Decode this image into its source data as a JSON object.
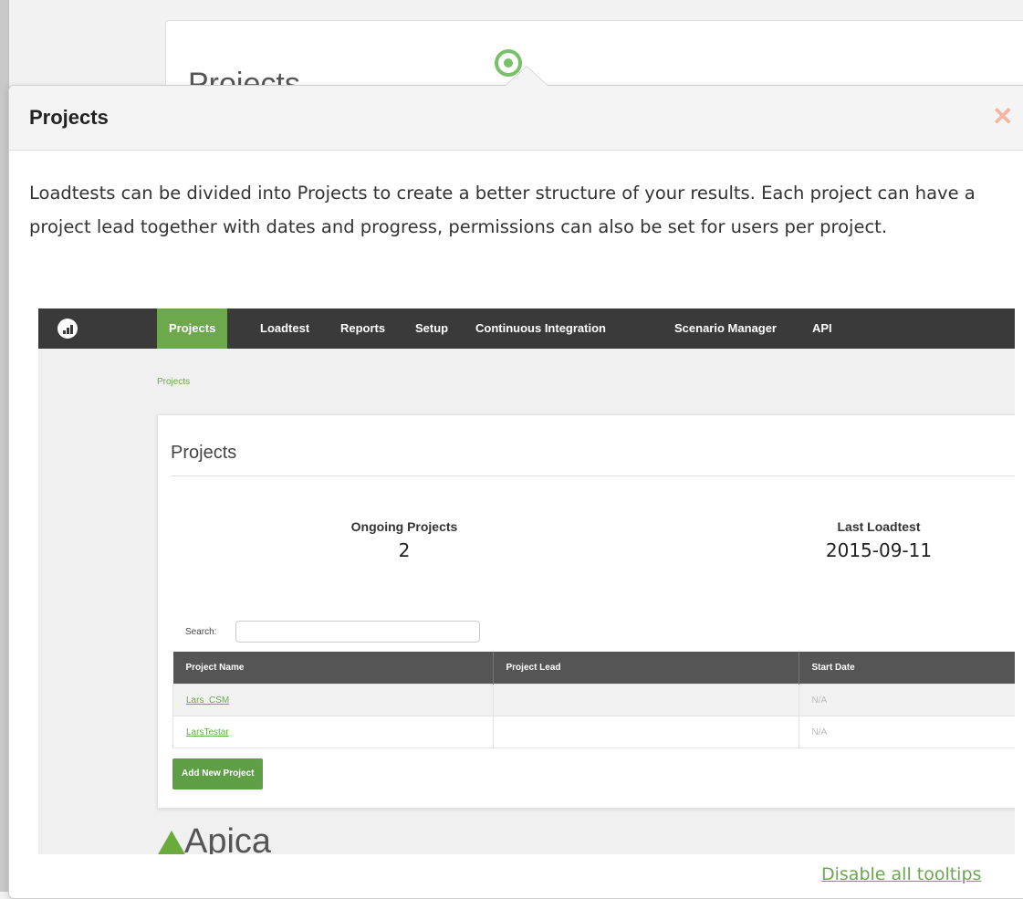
{
  "background": {
    "card_title": "Projects"
  },
  "popover": {
    "title": "Projects",
    "close_glyph": "✕",
    "description": "Loadtests can be divided into Projects to create a better structure of your results. Each project can have a project lead together with dates and progress, permissions can also be set for users per project.",
    "footer_link": "Disable all tooltips"
  },
  "screenshot": {
    "nav": {
      "logo_icon": "chart-logo-icon",
      "items": [
        "Projects",
        "Loadtest",
        "Reports",
        "Setup",
        "Continuous Integration",
        "Scenario Manager",
        "API"
      ],
      "active_index": 0
    },
    "breadcrumb": "Projects",
    "card": {
      "title": "Projects",
      "stats": [
        {
          "label": "Ongoing Projects",
          "value": "2"
        },
        {
          "label": "Last Loadtest",
          "value": "2015-09-11"
        }
      ],
      "search_label": "Search:",
      "search_value": "",
      "table": {
        "columns": [
          "Project Name",
          "Project Lead",
          "Start Date"
        ],
        "rows": [
          [
            "Lars_CSM",
            "",
            "N/A"
          ],
          [
            "LarsTestar",
            "",
            "N/A"
          ]
        ]
      },
      "add_button": "Add New Project"
    },
    "brand": "Apica"
  },
  "colors": {
    "accent": "#6aa84f",
    "nav_bg": "#3a3a3a",
    "close": "#f1b7a3"
  }
}
